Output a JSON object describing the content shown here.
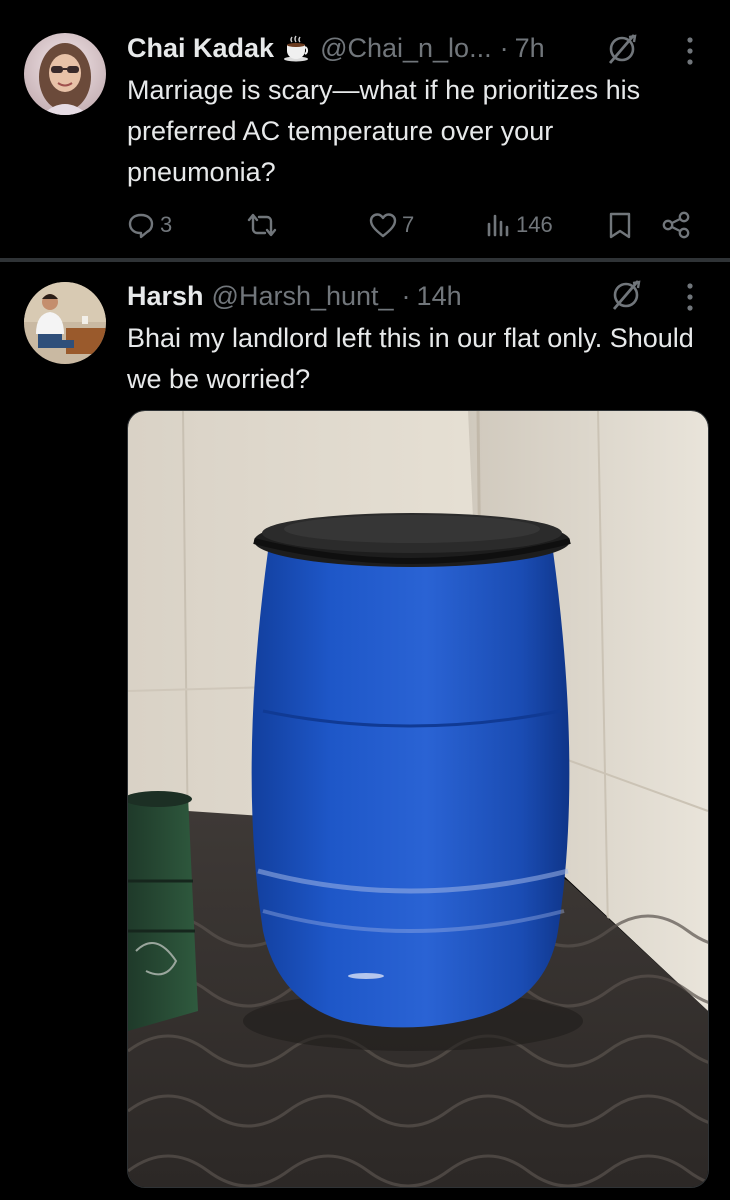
{
  "tweets": [
    {
      "author_name": "Chai Kadak",
      "handle": "@Chai_n_lo...",
      "separator": "·",
      "time": "7h",
      "text": "Marriage is scary—what if he prioritizes his preferred AC temperature over your pneumonia?",
      "replies": "3",
      "likes": "7",
      "views": "146"
    },
    {
      "author_name": "Harsh",
      "handle": "@Harsh_hunt_",
      "separator": "·",
      "time": "14h",
      "text": "Bhai my landlord left this in our flat only. Should we be worried?"
    }
  ],
  "icons": {
    "emoji": "coffee-cup-emoji",
    "grok": "grok-icon",
    "more": "more-vertical-icon",
    "reply": "reply-icon",
    "retweet": "retweet-icon",
    "like": "heart-icon",
    "views": "views-chart-icon",
    "bookmark": "bookmark-icon",
    "share": "share-icon"
  },
  "colors": {
    "background": "#000000",
    "text": "#e7e9ea",
    "muted": "#71767b",
    "divider": "#2f3336",
    "drum_blue": "#1f55c6"
  }
}
